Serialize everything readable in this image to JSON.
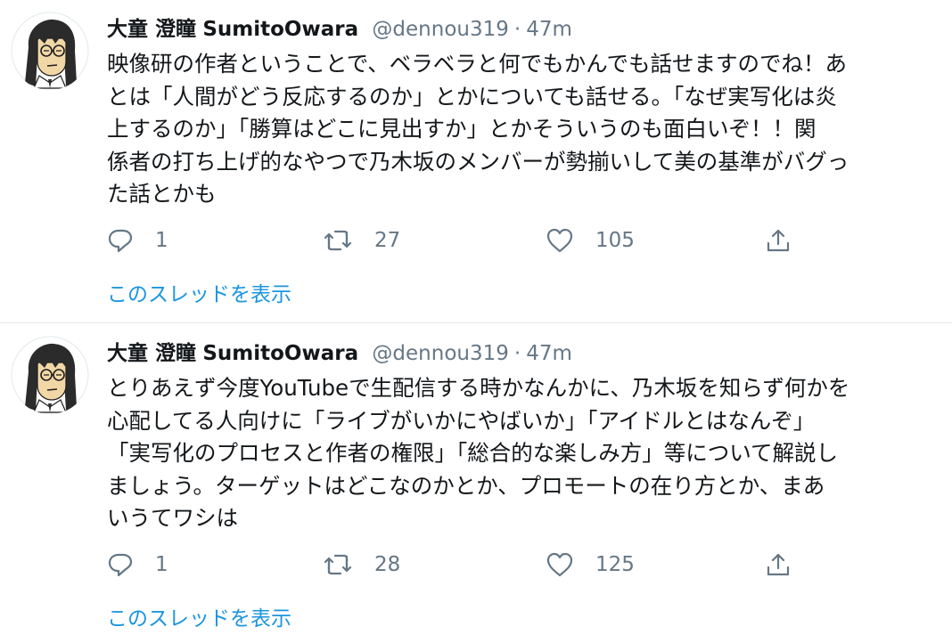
{
  "colors": {
    "text_primary": "#14171a",
    "text_secondary": "#657786",
    "link": "#1b95e0",
    "divider": "#e6ecf0"
  },
  "tweets": [
    {
      "display_name": "大童 澄瞳",
      "username": "SumitoOwara",
      "handle": "@dennou319",
      "separator": "·",
      "time": "47m",
      "avatar_icon": "illustrated-character-avatar",
      "text": "映像研の作者ということで、ベラベラと何でもかんでも話せますのでね！あ\nとは「人間がどう反応するのか」とかについても話せる。「なぜ実写化は炎\n上するのか」「勝算はどこに見出すか」とかそういうのも面白いぞ！！関\n係者の打ち上げ的なやつで乃木坂のメンバーが勢揃いして美の基準がバグっ\nた話とかも",
      "replies": "1",
      "retweets": "27",
      "likes": "105",
      "thread_link": "このスレッドを表示"
    },
    {
      "display_name": "大童 澄瞳",
      "username": "SumitoOwara",
      "handle": "@dennou319",
      "separator": "·",
      "time": "47m",
      "avatar_icon": "illustrated-character-avatar",
      "text": "とりあえず今度YouTubeで生配信する時かなんかに、乃木坂を知らず何かを\n心配してる人向けに「ライブがいかにやばいか」「アイドルとはなんぞ」\n「実写化のプロセスと作者の権限」「総合的な楽しみ方」等について解説し\nましょう。ターゲットはどこなのかとか、プロモートの在り方とか、まあ\nいうてワシは",
      "replies": "1",
      "retweets": "28",
      "likes": "125",
      "thread_link": "このスレッドを表示"
    }
  ]
}
